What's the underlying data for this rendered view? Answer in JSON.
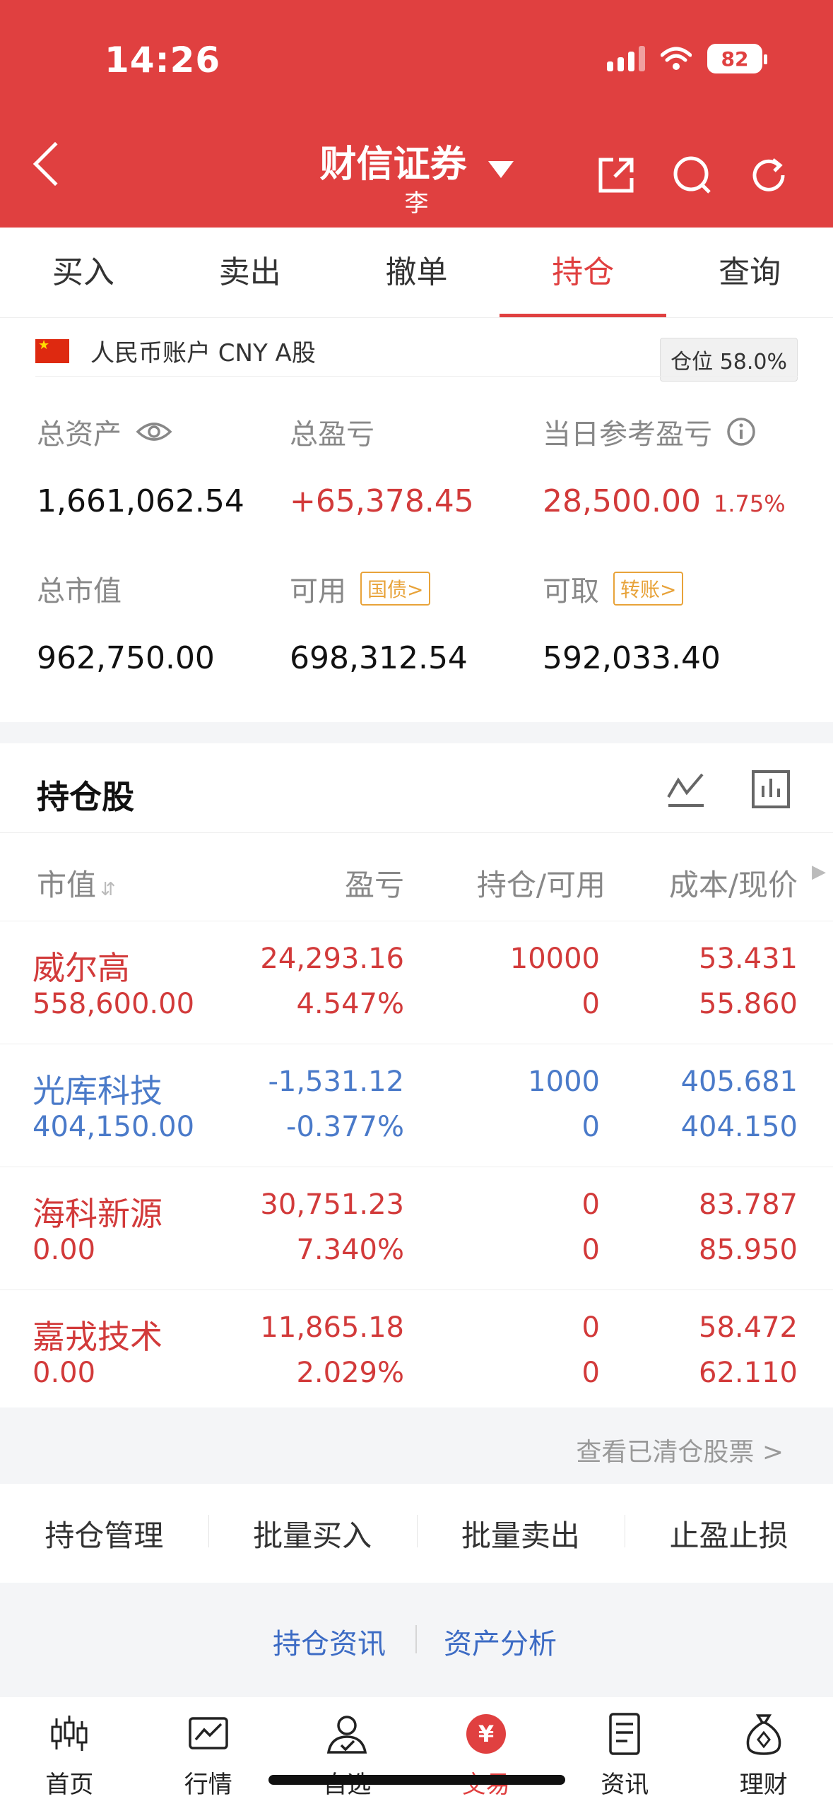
{
  "status_bar": {
    "time": "14:26",
    "battery": "82"
  },
  "header": {
    "title": "财信证券",
    "subtitle": "李"
  },
  "tabs": [
    {
      "label": "买入"
    },
    {
      "label": "卖出"
    },
    {
      "label": "撤单"
    },
    {
      "label": "持仓",
      "active": true
    },
    {
      "label": "查询"
    }
  ],
  "account": {
    "label": "人民币账户 CNY A股",
    "position_label": "仓位 58.0%",
    "total_assets_label": "总资产",
    "total_assets": "1,661,062.54",
    "total_pl_label": "总盈亏",
    "total_pl": "+65,378.45",
    "daily_pl_label": "当日参考盈亏",
    "daily_pl": "28,500.00",
    "daily_pl_pct": "1.75%",
    "market_value_label": "总市值",
    "market_value": "962,750.00",
    "available_label": "可用",
    "available_tag": "国债>",
    "available": "698,312.54",
    "withdrawable_label": "可取",
    "withdrawable_tag": "转账>",
    "withdrawable": "592,033.40"
  },
  "holdings": {
    "title": "持仓股",
    "columns": [
      "市值",
      "盈亏",
      "持仓/可用",
      "成本/现价"
    ],
    "rows": [
      {
        "name": "威尔高",
        "market_value": "558,600.00",
        "pl": "24,293.16",
        "pl_pct": "4.547%",
        "position": "10000",
        "available": "0",
        "cost": "53.431",
        "price": "55.860",
        "color": "red"
      },
      {
        "name": "光库科技",
        "market_value": "404,150.00",
        "pl": "-1,531.12",
        "pl_pct": "-0.377%",
        "position": "1000",
        "available": "0",
        "cost": "405.681",
        "price": "404.150",
        "color": "blue"
      },
      {
        "name": "海科新源",
        "market_value": "0.00",
        "pl": "30,751.23",
        "pl_pct": "7.340%",
        "position": "0",
        "available": "0",
        "cost": "83.787",
        "price": "85.950",
        "color": "red"
      },
      {
        "name": "嘉戎技术",
        "market_value": "0.00",
        "pl": "11,865.18",
        "pl_pct": "2.029%",
        "position": "0",
        "available": "0",
        "cost": "58.472",
        "price": "62.110",
        "color": "red"
      }
    ],
    "cleared_link": "查看已清仓股票 >"
  },
  "actions": [
    "持仓管理",
    "批量买入",
    "批量卖出",
    "止盈止损"
  ],
  "links": [
    "持仓资讯",
    "资产分析"
  ],
  "nav": [
    {
      "label": "首页",
      "icon": "candlestick-icon"
    },
    {
      "label": "行情",
      "icon": "chart-icon"
    },
    {
      "label": "自选",
      "icon": "user-icon"
    },
    {
      "label": "交易",
      "icon": "yuan-icon",
      "active": true
    },
    {
      "label": "资讯",
      "icon": "document-icon"
    },
    {
      "label": "理财",
      "icon": "moneybag-icon"
    }
  ],
  "colors": {
    "brand": "#e04040",
    "gain": "#d23a3a",
    "loss": "#4a7ac9",
    "tag": "#e8a33a"
  }
}
